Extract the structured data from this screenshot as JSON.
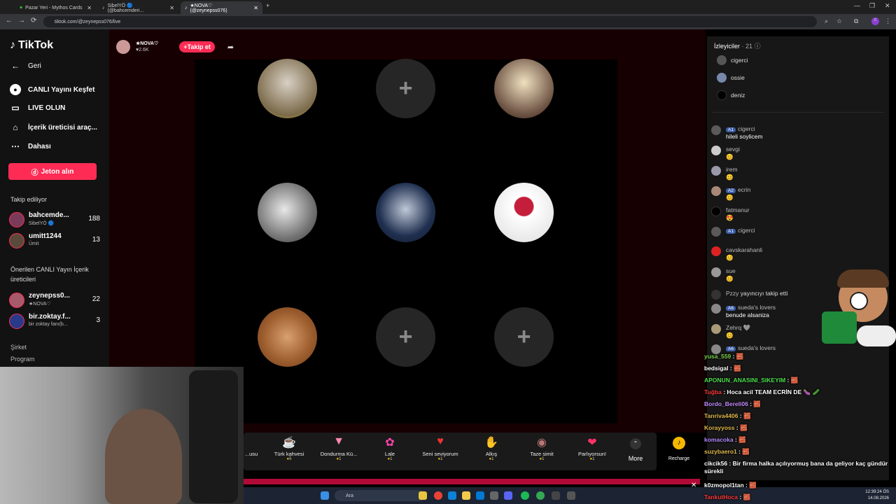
{
  "tabs": [
    {
      "title": "Pazar Yeri - Mythos Cards"
    },
    {
      "title": "SibelYÖ 🔵 (@bahcemderi..."
    },
    {
      "title": "★NOVA♡ (@zeynepss076)"
    }
  ],
  "address": "tiktok.com/@zeynepss076/live",
  "brand": "TikTok",
  "sidebar": {
    "back": "Geri",
    "items": [
      {
        "label": "CANLI Yayını Keşfet",
        "icon": "live-discover-icon"
      },
      {
        "label": "LIVE OLUN",
        "icon": "video-camera-icon"
      },
      {
        "label": "İçerik üreticisi araç...",
        "icon": "house-icon"
      },
      {
        "label": "Dahası",
        "icon": "more-dots-icon"
      }
    ],
    "coin_button": "Jeton alın",
    "following_title": "Takip ediliyor",
    "following": [
      {
        "name": "bahcemde...",
        "sub": "SibelYÖ 🔵",
        "count": "188"
      },
      {
        "name": "umitt1244",
        "sub": "Ümit",
        "count": "13"
      }
    ],
    "suggested_title": "Önerilen CANLI Yayın İçerik üreticileri",
    "suggested": [
      {
        "name": "zeynepss0...",
        "sub": "★NOVA♡",
        "count": "22"
      },
      {
        "name": "bir.zoktay.f...",
        "sub": "bir zoktay fanı(b...",
        "count": "3"
      }
    ],
    "footer": [
      "Şirket",
      "Program"
    ]
  },
  "host": {
    "name": "★NOVA♡",
    "likes": "♥2.6K",
    "follow": "+Takip et"
  },
  "gifts": [
    {
      "name": "...usu",
      "price": "",
      "icon": "gift-partial-icon"
    },
    {
      "name": "Türk kahvesi",
      "price": "5",
      "icon": "coffee-icon"
    },
    {
      "name": "Dondurma Kü...",
      "price": "1",
      "icon": "ice-cream-icon"
    },
    {
      "name": "Lale",
      "price": "1",
      "icon": "tulip-icon"
    },
    {
      "name": "Seni seviyorum",
      "price": "1",
      "icon": "heart-face-icon"
    },
    {
      "name": "Alkış",
      "price": "1",
      "icon": "clap-icon"
    },
    {
      "name": "Taze simit",
      "price": "1",
      "icon": "simit-icon"
    },
    {
      "name": "Parlıyorsun!",
      "price": "1",
      "icon": "shining-heart-icon"
    }
  ],
  "more": "More",
  "recharge": "Recharge",
  "viewers_title": "İzleyiciler",
  "viewers_count": "· 21",
  "viewers": [
    "cigerci",
    "ossie",
    "deniz"
  ],
  "chat": [
    {
      "name": "cigerci",
      "badge": "A1",
      "text": "hileli soylicem"
    },
    {
      "name": "sevgi",
      "badge": "",
      "text": "😊"
    },
    {
      "name": "irem",
      "badge": "",
      "text": "😊"
    },
    {
      "name": "ecrin",
      "badge": "A2",
      "text": "😊"
    },
    {
      "name": "fatmanur",
      "badge": "",
      "text": "😍"
    },
    {
      "name": "cigerci",
      "badge": "A1",
      "text": ""
    },
    {
      "name": "cavskarahanli",
      "badge": "",
      "text": "😊"
    },
    {
      "name": "sue",
      "badge": "",
      "text": "😊"
    },
    {
      "name": "Pzzy",
      "badge": "",
      "text": "yayıncıyı takip etti"
    },
    {
      "name": "sueda's lovers",
      "badge": "A6",
      "text": "benude alsaniza"
    },
    {
      "name": "Zehrq 🩶",
      "badge": "",
      "text": "😊"
    },
    {
      "name": "sueda's lovers",
      "badge": "A6",
      "text": ""
    }
  ],
  "overlay": [
    {
      "user": "yusa_559",
      "msg": " : 🧱",
      "color": "#7cd14a"
    },
    {
      "user": "bedsigal",
      "msg": " : 🧱",
      "color": "#ffffff"
    },
    {
      "user": "APONUN_ANASINI_SIKEYIM",
      "msg": " : 🧱",
      "color": "#4ce24c"
    },
    {
      "user": "Tuğba",
      "msg": " : Hoca acil TEAM ECRİN DE 🍆 🥒",
      "color": "#ff3b3b"
    },
    {
      "user": "Bordo_Bereli06",
      "msg": " : 🧱",
      "color": "#c48bff"
    },
    {
      "user": "Tanriva4406",
      "msg": " : 🧱",
      "color": "#e0b84a"
    },
    {
      "user": "Korayyoss",
      "msg": " : 🧱",
      "color": "#e0b84a"
    },
    {
      "user": "komacoka",
      "msg": " : 🧱",
      "color": "#b388ff"
    },
    {
      "user": "suzybaero1",
      "msg": " : 🧱",
      "color": "#e0b84a"
    },
    {
      "user": "cikcik56",
      "msg": " : Bir firma halka açılıyormuş bana da geliyor kaç gündür sürekli",
      "color": "#ffffff"
    },
    {
      "user": "k0zmopol1tan",
      "msg": " : 🧱",
      "color": "#ffffff"
    },
    {
      "user": "TankutHoca",
      "msg": " : 🧱",
      "color": "#ff3b3b"
    }
  ],
  "taskbar": {
    "search": "Ara",
    "time": "12:39:24 ÖS",
    "date": "14.08.2026"
  },
  "colors": {
    "accent": "#fe2c55",
    "panel": "#171717",
    "stage": "#170002"
  }
}
